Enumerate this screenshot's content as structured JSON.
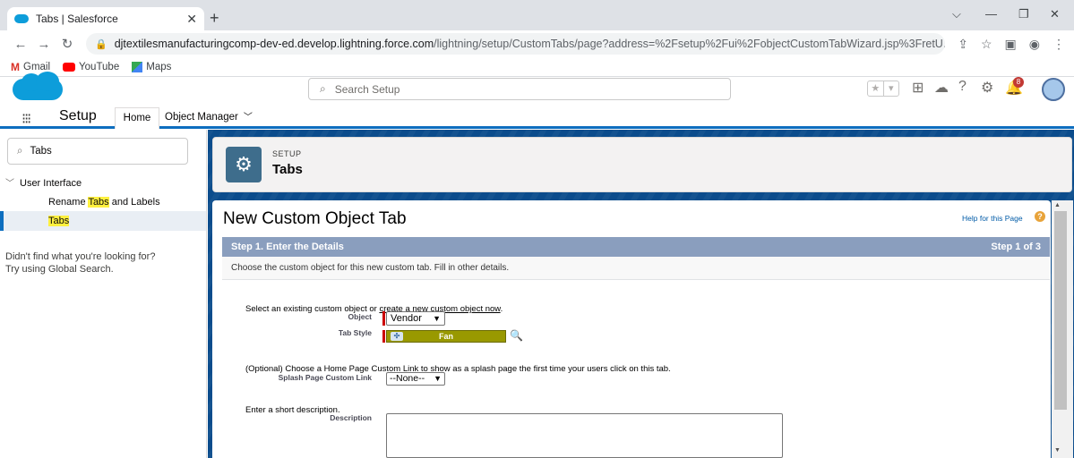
{
  "browser": {
    "tab_title": "Tabs | Salesforce",
    "url_host": "djtextilesmanufacturingcomp-dev-ed.develop.lightning.force.com",
    "url_path": "/lightning/setup/CustomTabs/page?address=%2Fsetup%2Fui%2FobjectCustomTabWizard.jsp%3FretU...",
    "bookmarks": [
      "Gmail",
      "YouTube",
      "Maps"
    ]
  },
  "sf": {
    "search_placeholder": "Search Setup",
    "notification_count": "8",
    "app_name": "Setup",
    "nav_home": "Home",
    "nav_object_manager": "Object Manager"
  },
  "sidebar": {
    "quick_find_value": "Tabs",
    "section": "User Interface",
    "item_rename_pre": "Rename ",
    "item_rename_hl": "Tabs",
    "item_rename_post": " and Labels",
    "item_tabs": "Tabs",
    "not_found_line1": "Didn't find what you're looking for?",
    "not_found_line2": "Try using Global Search."
  },
  "header": {
    "eyebrow": "SETUP",
    "title": "Tabs"
  },
  "wizard": {
    "title": "New Custom Object Tab",
    "help_link": "Help for this Page",
    "step_title": "Step 1. Enter the Details",
    "step_count": "Step 1 of 3",
    "step_desc": "Choose the custom object for this new custom tab. Fill in other details.",
    "select_intro": "Select an existing custom object or ",
    "create_link": "create a new custom object now",
    "select_intro_end": ".",
    "object_label": "Object",
    "object_value": "Vendor",
    "tab_style_label": "Tab Style",
    "tab_style_value": "Fan",
    "splash_intro": "(Optional) Choose a Home Page Custom Link to show as a splash page the first time your users click on this tab.",
    "splash_label": "Splash Page Custom Link",
    "splash_value": "--None--",
    "desc_intro": "Enter a short description.",
    "desc_label": "Description",
    "desc_value": ""
  }
}
